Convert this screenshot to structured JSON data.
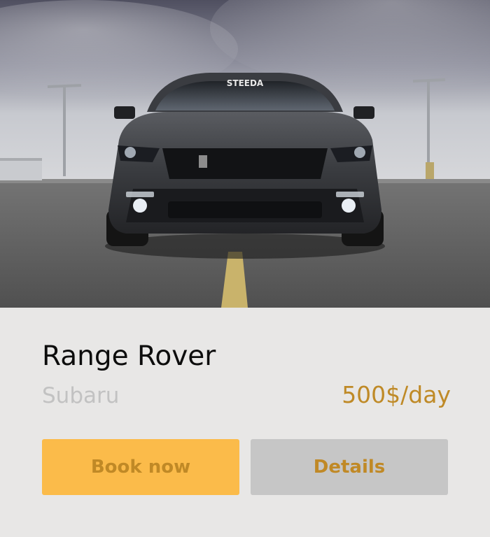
{
  "car": {
    "model": "Range Rover",
    "brand": "Subaru",
    "price": "500$/day",
    "image_plate_text": "STEEDA"
  },
  "actions": {
    "book_label": "Book now",
    "details_label": "Details"
  },
  "colors": {
    "accent": "#fbbb4a",
    "price_text": "#bf8a27",
    "secondary_button": "#c6c6c6",
    "background": "#e8e7e6"
  }
}
